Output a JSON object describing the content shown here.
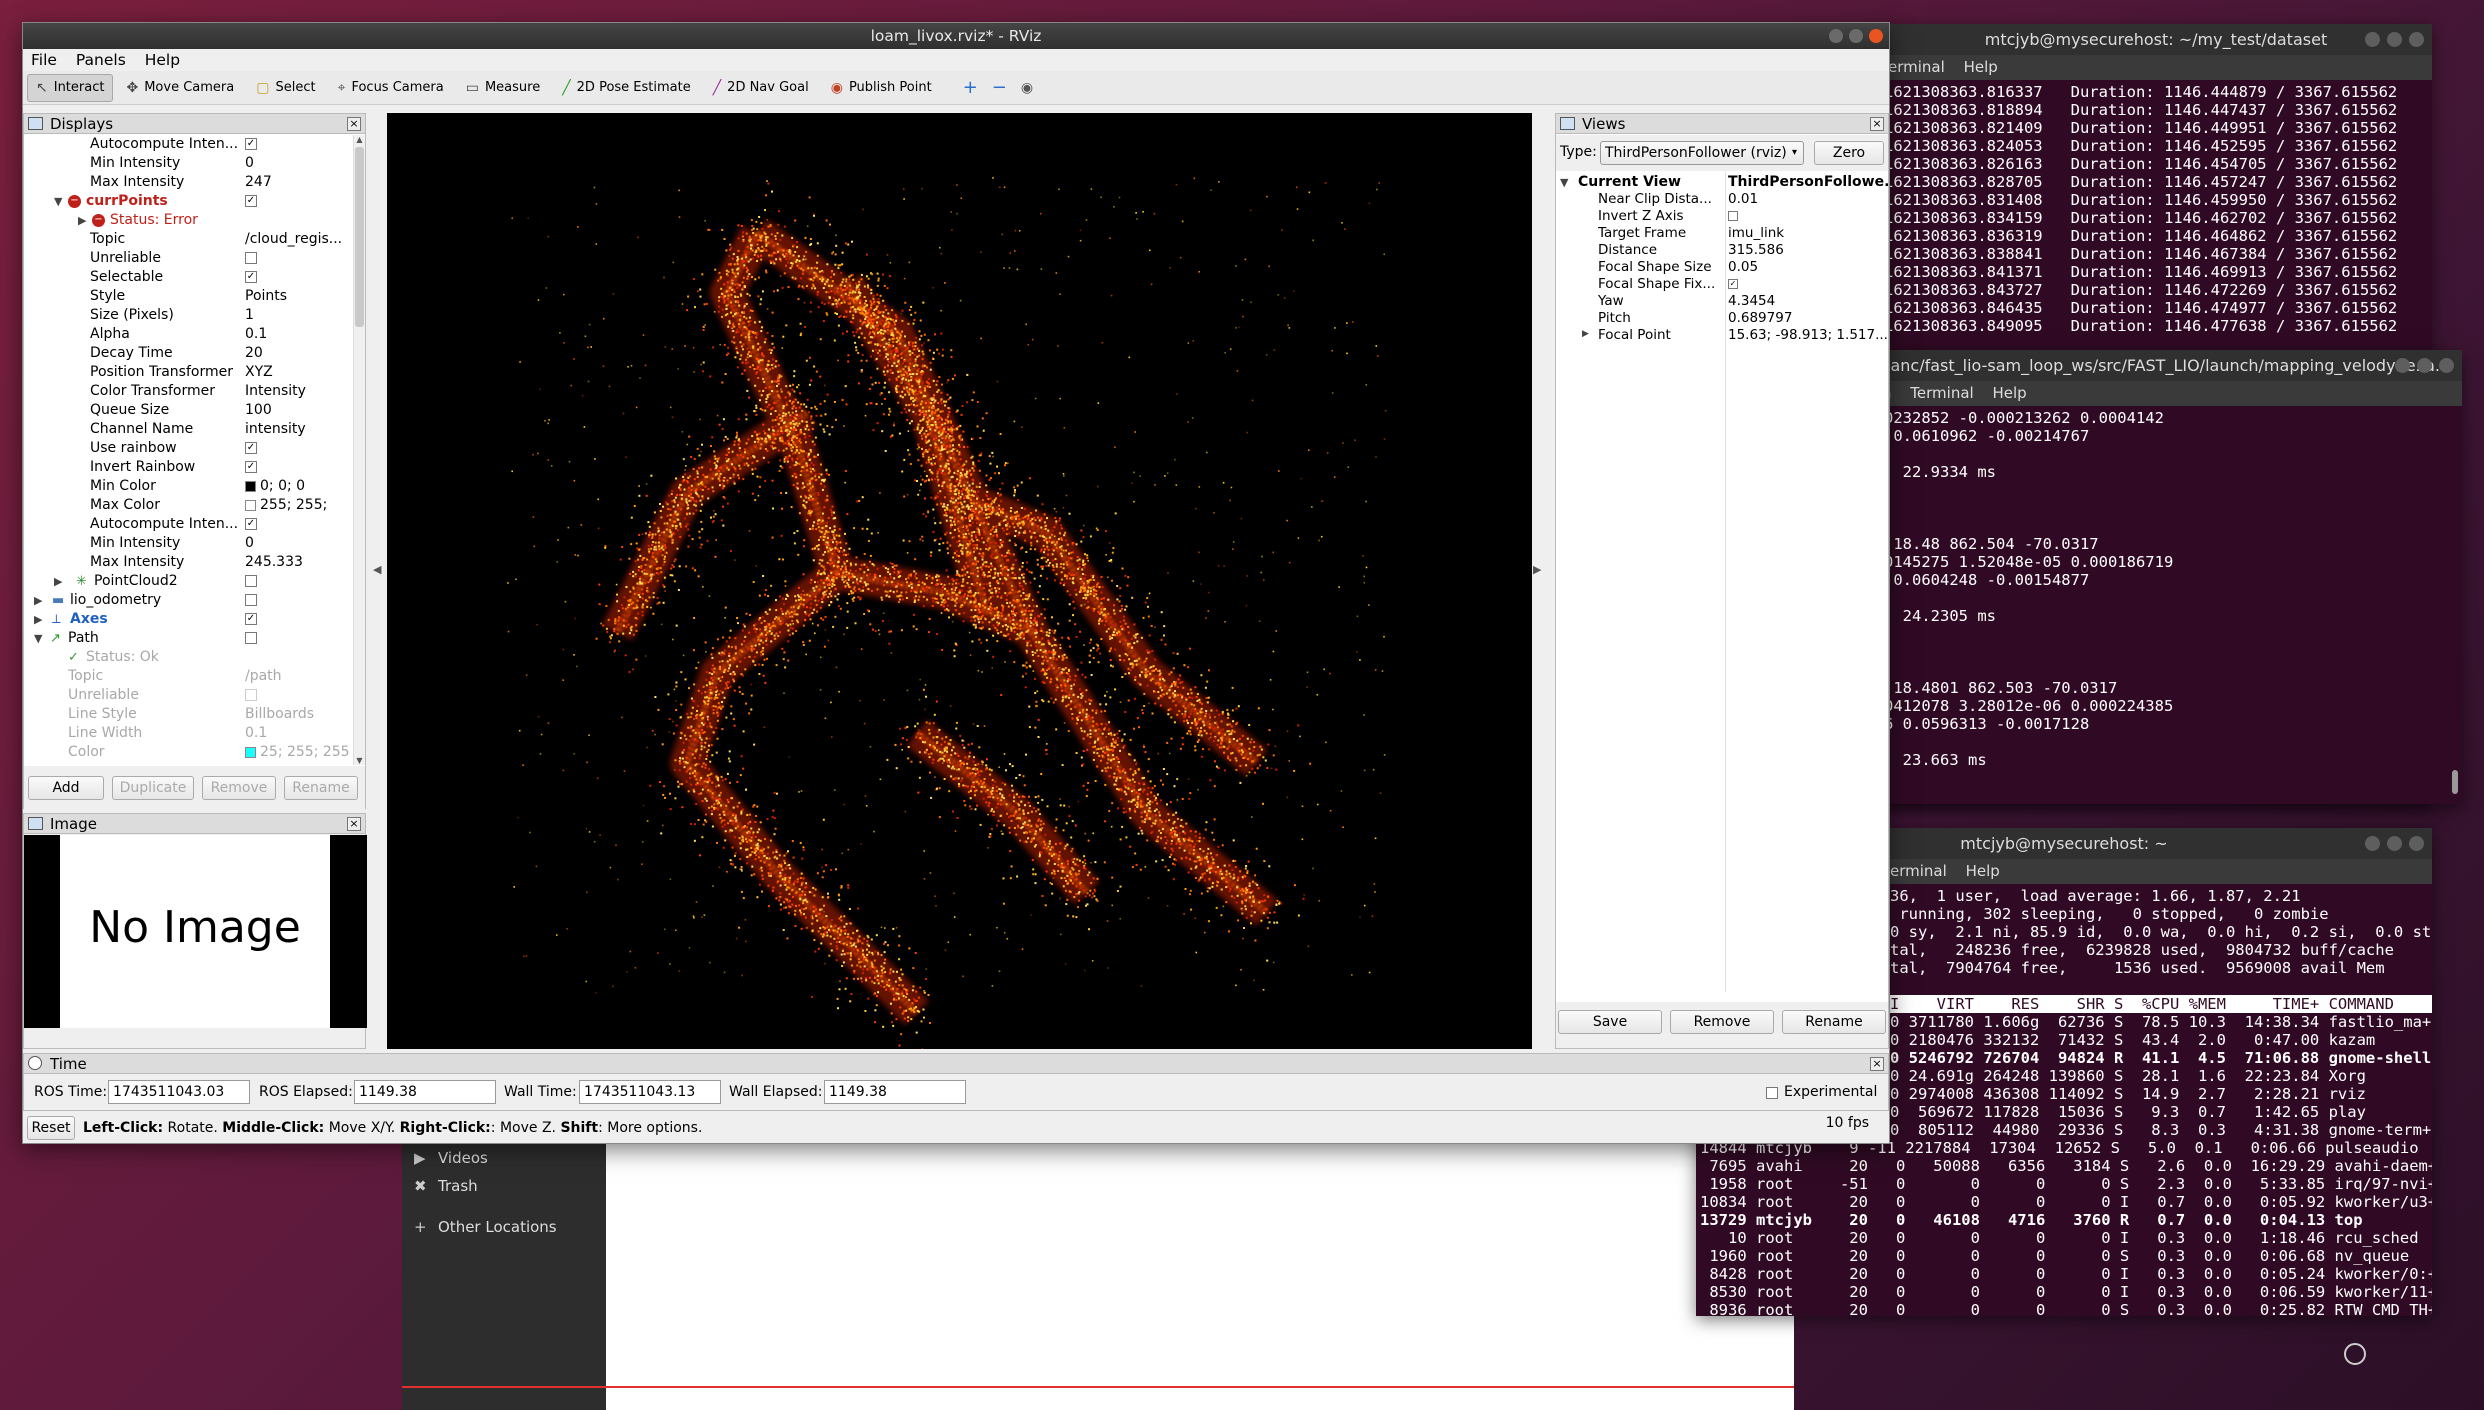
{
  "terminal1": {
    "title": "mtcjyb@mysecurehost: ~/my_test/dataset",
    "menu": [
      "erminal",
      "Help"
    ],
    "rows": [
      {
        "ts": "1621308363.816337",
        "dur": "Duration: 1146.444879 / 3367.615562"
      },
      {
        "ts": "1621308363.818894",
        "dur": "Duration: 1146.447437 / 3367.615562"
      },
      {
        "ts": "1621308363.821409",
        "dur": "Duration: 1146.449951 / 3367.615562"
      },
      {
        "ts": "1621308363.824053",
        "dur": "Duration: 1146.452595 / 3367.615562"
      },
      {
        "ts": "1621308363.826163",
        "dur": "Duration: 1146.454705 / 3367.615562"
      },
      {
        "ts": "1621308363.828705",
        "dur": "Duration: 1146.457247 / 3367.615562"
      },
      {
        "ts": "1621308363.831408",
        "dur": "Duration: 1146.459950 / 3367.615562"
      },
      {
        "ts": "1621308363.834159",
        "dur": "Duration: 1146.462702 / 3367.615562"
      },
      {
        "ts": "1621308363.836319",
        "dur": "Duration: 1146.464862 / 3367.615562"
      },
      {
        "ts": "1621308363.838841",
        "dur": "Duration: 1146.467384 / 3367.615562"
      },
      {
        "ts": "1621308363.841371",
        "dur": "Duration: 1146.469913 / 3367.615562"
      },
      {
        "ts": "1621308363.843727",
        "dur": "Duration: 1146.472269 / 3367.615562"
      },
      {
        "ts": "1621308363.846435",
        "dur": "Duration: 1146.474977 / 3367.615562"
      },
      {
        "ts": "1621308363.849095",
        "dur": "Duration: 1146.477638 / 3367.615562"
      }
    ]
  },
  "terminal2": {
    "title": "ianc/fast_lio-sam_loop_ws/src/FAST_LIO/launch/mapping_velodyne.la...",
    "menu": [
      "h",
      "Terminal",
      "Help"
    ],
    "lines": [
      "0232852 -0.000213262 0.0004142",
      " 0.0610962 -0.00214767",
      "",
      ": 22.9334 ms",
      "",
      "",
      "",
      " 18.48 862.504 -70.0317",
      "0145275 1.52048e-05 0.000186719",
      " 0.0604248 -0.00154877",
      "",
      ": 24.2305 ms",
      "",
      "",
      "",
      " 18.4801 862.503 -70.0317",
      "0412078 3.28012e-06 0.000224385",
      "6 0.0596313 -0.0017128",
      "",
      ": 23.663 ms"
    ]
  },
  "terminal3": {
    "title": "mtcjyb@mysecurehost: ~",
    "menu": [
      "erminal",
      "Help"
    ],
    "header": [
      "36,  1 user,  load average: 1.66, 1.87, 2.21",
      " running, 302 sleeping,   0 stopped,   0 zombie",
      "0 sy,  2.1 ni, 85.9 id,  0.0 wa,  0.0 hi,  0.2 si,  0.0 st",
      "tal,   248236 free,  6239828 used,  9804732 buff/cache",
      "tal,  7904764 free,     1536 used.  9569008 avail Mem"
    ],
    "col_header": "I    VIRT    RES    SHR S  %CPU %MEM     TIME+ COMMAND",
    "procs": [
      {
        "t": "0 3711780 1.606g  62736 S  78.5 10.3  14:38.34 fastlio_ma+",
        "b": false
      },
      {
        "t": "0 2180476 332132  71432 S  43.4  2.0   0:47.00 kazam",
        "b": false
      },
      {
        "t": "0 5246792 726704  94824 R  41.1  4.5  71:06.88 gnome-shell",
        "b": true
      },
      {
        "t": "0 24.691g 264248 139860 S  28.1  1.6  22:23.84 Xorg",
        "b": false
      },
      {
        "t": "0 2974008 436308 114092 S  14.9  2.7   2:28.21 rviz",
        "b": false
      },
      {
        "t": "0  569672 117828  15036 S   9.3  0.7   1:42.65 play",
        "b": false
      },
      {
        "t": "0  805112  44980  29336 S   8.3  0.3   4:31.38 gnome-term+",
        "b": false
      },
      {
        "t": "14844 mtcjyb    9 -11 2217884  17304  12652 S   5.0  0.1   0:06.66 pulseaudio",
        "b": false
      },
      {
        "t": " 7695 avahi     20   0   50088   6356   3184 S   2.6  0.0  16:29.29 avahi-daem+",
        "b": false
      },
      {
        "t": " 1958 root     -51   0       0      0      0 S   2.3  0.0   5:33.85 irq/97-nvi+",
        "b": false
      },
      {
        "t": "10834 root      20   0       0      0      0 I   0.7  0.0   0:05.92 kworker/u3+",
        "b": false
      },
      {
        "t": "13729 mtcjyb    20   0   46108   4716   3760 R   0.7  0.0   0:04.13 top",
        "b": true
      },
      {
        "t": "   10 root      20   0       0      0      0 I   0.3  0.0   1:18.46 rcu_sched",
        "b": false
      },
      {
        "t": " 1960 root      20   0       0      0      0 S   0.3  0.0   0:06.68 nv_queue",
        "b": false
      },
      {
        "t": " 8428 root      20   0       0      0      0 I   0.3  0.0   0:05.24 kworker/0:+",
        "b": false
      },
      {
        "t": " 8530 root      20   0       0      0      0 I   0.3  0.0   0:06.59 kworker/11+",
        "b": false
      },
      {
        "t": " 8936 root      20   0       0      0      0 S   0.3  0.0   0:25.82 RTW_CMD_TH+",
        "b": false
      }
    ]
  },
  "files": {
    "items": [
      {
        "icon": "video-icon",
        "glyph": "▶",
        "label": "Videos"
      },
      {
        "icon": "trash-icon",
        "glyph": "✖",
        "label": "Trash"
      },
      {
        "icon": "plus-icon",
        "glyph": "+",
        "label": "Other Locations"
      }
    ]
  },
  "rviz": {
    "title": "loam_livox.rviz* - RViz",
    "menu": {
      "file": "File",
      "panels": "Panels",
      "help": "Help"
    },
    "toolbar": [
      {
        "name": "interact-tool",
        "icon": "cursor-icon",
        "glyph": "↖",
        "label": "Interact",
        "active": true
      },
      {
        "name": "move-camera-tool",
        "icon": "camera-icon",
        "glyph": "✥",
        "label": "Move Camera",
        "active": false
      },
      {
        "name": "select-tool",
        "icon": "select-box-icon",
        "glyph": "▢",
        "label": "Select",
        "active": false
      },
      {
        "name": "focus-camera-tool",
        "icon": "target-icon",
        "glyph": "⌖",
        "label": "Focus Camera",
        "active": false
      },
      {
        "name": "measure-tool",
        "icon": "ruler-icon",
        "glyph": "▭",
        "label": "Measure",
        "active": false
      },
      {
        "name": "pose-estimate-tool",
        "icon": "green-arrow-icon",
        "glyph": "╱",
        "label": "2D Pose Estimate",
        "active": false
      },
      {
        "name": "nav-goal-tool",
        "icon": "purple-arrow-icon",
        "glyph": "╱",
        "label": "2D Nav Goal",
        "active": false
      },
      {
        "name": "publish-point-tool",
        "icon": "map-pin-icon",
        "glyph": "◉",
        "label": "Publish Point",
        "active": false
      }
    ],
    "displays": {
      "title": "Displays",
      "rows": [
        {
          "label": "Autocompute Inten...",
          "value": "",
          "check": true,
          "indent": 1
        },
        {
          "label": "Min Intensity",
          "value": "0",
          "indent": 1
        },
        {
          "label": "Max Intensity",
          "value": "247",
          "indent": 1
        },
        {
          "label": "currPoints",
          "value": "",
          "check": true,
          "indent": 0,
          "error": true,
          "expanded": true
        },
        {
          "label": "Status: Error",
          "value": "",
          "indent": 1,
          "error": true,
          "arrow": true
        },
        {
          "label": "Topic",
          "value": "/cloud_regis...",
          "indent": 1
        },
        {
          "label": "Unreliable",
          "value": "",
          "check": false,
          "indent": 1
        },
        {
          "label": "Selectable",
          "value": "",
          "check": true,
          "indent": 1
        },
        {
          "label": "Style",
          "value": "Points",
          "indent": 1
        },
        {
          "label": "Size (Pixels)",
          "value": "1",
          "indent": 1
        },
        {
          "label": "Alpha",
          "value": "0.1",
          "indent": 1
        },
        {
          "label": "Decay Time",
          "value": "20",
          "indent": 1
        },
        {
          "label": "Position Transformer",
          "value": "XYZ",
          "indent": 1
        },
        {
          "label": "Color Transformer",
          "value": "Intensity",
          "indent": 1
        },
        {
          "label": "Queue Size",
          "value": "100",
          "indent": 1
        },
        {
          "label": "Channel Name",
          "value": "intensity",
          "indent": 1
        },
        {
          "label": "Use rainbow",
          "value": "",
          "check": true,
          "indent": 1
        },
        {
          "label": "Invert Rainbow",
          "value": "",
          "check": true,
          "indent": 1
        },
        {
          "label": "Min Color",
          "value": "0; 0; 0",
          "swatch": "#000000",
          "indent": 1
        },
        {
          "label": "Max Color",
          "value": "255; 255;",
          "swatch": "#ffffff",
          "indent": 1
        },
        {
          "label": "Autocompute Inten...",
          "value": "",
          "check": true,
          "indent": 1
        },
        {
          "label": "Min Intensity",
          "value": "0",
          "indent": 1
        },
        {
          "label": "Max Intensity",
          "value": "245.333",
          "indent": 1
        },
        {
          "label": "PointCloud2",
          "value": "",
          "check": false,
          "indent": 0,
          "arrow": true,
          "type": "pc2"
        },
        {
          "label": "lio_odometry",
          "value": "",
          "check": false,
          "indent": -1,
          "arrow": true,
          "type": "folder"
        },
        {
          "label": "Axes",
          "value": "",
          "check": true,
          "indent": -1,
          "arrow": true,
          "type": "axes"
        },
        {
          "label": "Path",
          "value": "",
          "check": false,
          "indent": -1,
          "expanded": true,
          "type": "path"
        },
        {
          "label": "Status: Ok",
          "value": "",
          "indent": 0,
          "dim": true,
          "ok": true
        },
        {
          "label": "Topic",
          "value": "/path",
          "indent": 0,
          "dim": true
        },
        {
          "label": "Unreliable",
          "value": "",
          "check": false,
          "indent": 0,
          "dim": true
        },
        {
          "label": "Line Style",
          "value": "Billboards",
          "indent": 0,
          "dim": true
        },
        {
          "label": "Line Width",
          "value": "0.1",
          "indent": 0,
          "dim": true
        },
        {
          "label": "Color",
          "value": "25; 255; 255",
          "swatch": "#19ffff",
          "indent": 0,
          "dim": true
        }
      ],
      "buttons": {
        "add": "Add",
        "duplicate": "Duplicate",
        "remove": "Remove",
        "rename": "Rename"
      }
    },
    "image": {
      "title": "Image",
      "placeholder": "No Image"
    },
    "views": {
      "title": "Views",
      "type_label": "Type:",
      "type_value": "ThirdPersonFollower (rviz)",
      "zero": "Zero",
      "current_view": "Current View",
      "current_view_value": "ThirdPersonFollowe...",
      "props": [
        {
          "k": "Near Clip Dista...",
          "v": "0.01"
        },
        {
          "k": "Invert Z Axis",
          "v": "",
          "check": false
        },
        {
          "k": "Target Frame",
          "v": "imu_link"
        },
        {
          "k": "Distance",
          "v": "315.586"
        },
        {
          "k": "Focal Shape Size",
          "v": "0.05"
        },
        {
          "k": "Focal Shape Fix...",
          "v": "",
          "check": true
        },
        {
          "k": "Yaw",
          "v": "4.3454"
        },
        {
          "k": "Pitch",
          "v": "0.689797"
        },
        {
          "k": "Focal Point",
          "v": "15.63; -98.913; 1.517...",
          "arrow": true
        }
      ],
      "buttons": {
        "save": "Save",
        "remove": "Remove",
        "rename": "Rename"
      }
    },
    "time": {
      "title": "Time",
      "ros_time_label": "ROS Time:",
      "ros_time": "1743511043.03",
      "ros_elapsed_label": "ROS Elapsed:",
      "ros_elapsed": "1149.38",
      "wall_time_label": "Wall Time:",
      "wall_time": "1743511043.13",
      "wall_elapsed_label": "Wall Elapsed:",
      "wall_elapsed": "1149.38",
      "experimental": "Experimental"
    },
    "status": {
      "reset": "Reset",
      "left_click": "Left-Click:",
      "left_desc": " Rotate. ",
      "middle_click": "Middle-Click:",
      "middle_desc": " Move X/Y. ",
      "right_click": "Right-Click:",
      "right_desc": ": Move Z. ",
      "shift": "Shift",
      "shift_desc": ": More options.",
      "fps": "10 fps"
    }
  },
  "colors": {
    "terminal_bg": "#300a24",
    "rviz_bg": "#efefef",
    "error": "#c0201a",
    "axes_blue": "#2060c0"
  }
}
